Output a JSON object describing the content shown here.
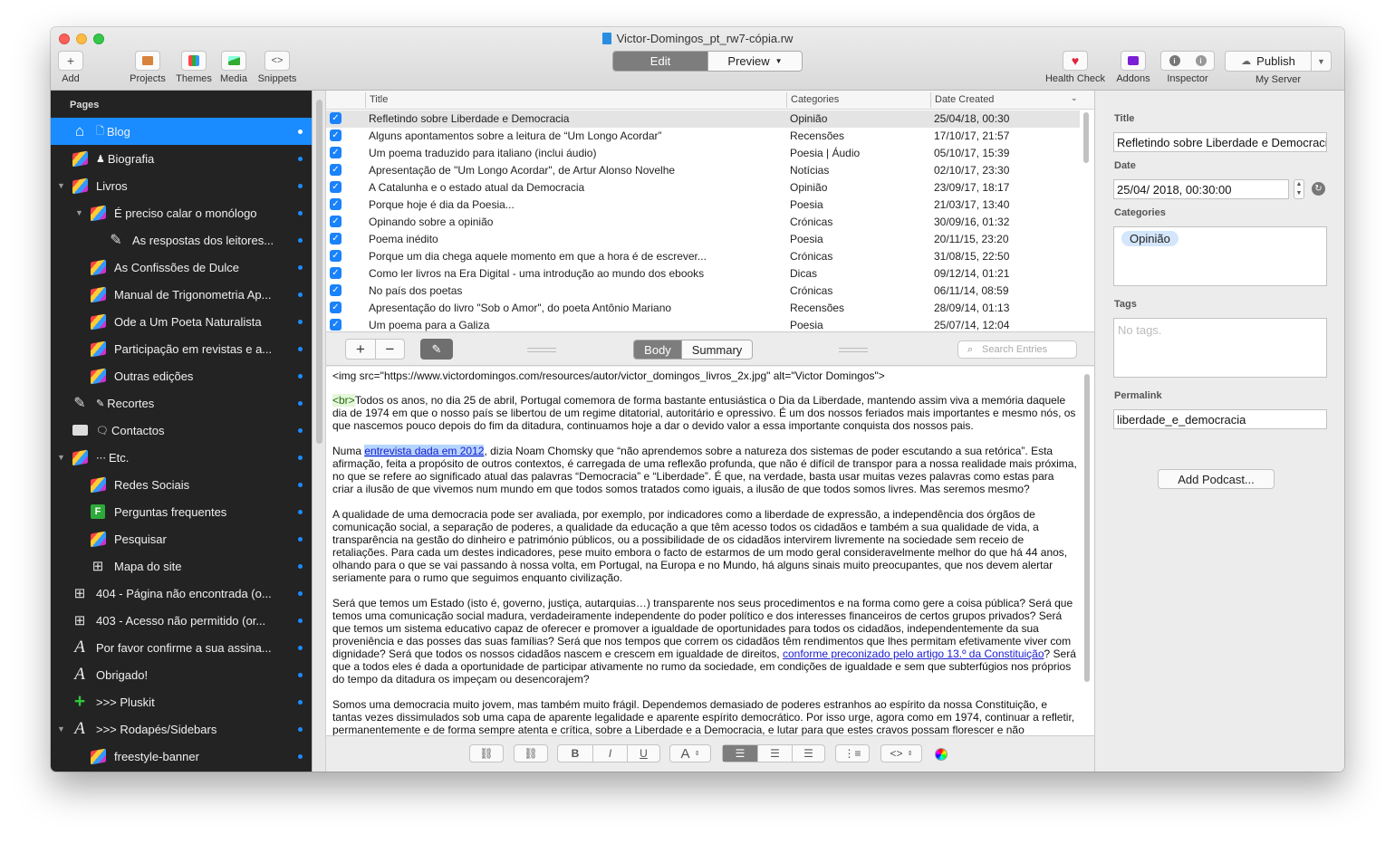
{
  "window": {
    "title": "Victor-Domingos_pt_rw7-cópia.rw"
  },
  "toolbar": {
    "add": "Add",
    "projects": "Projects",
    "themes": "Themes",
    "media": "Media",
    "snippets": "Snippets",
    "edit": "Edit",
    "preview": "Preview",
    "health_check": "Health Check",
    "addons": "Addons",
    "inspector": "Inspector",
    "publish": "Publish",
    "server": "My Server"
  },
  "sidebar": {
    "header": "Pages",
    "items": [
      {
        "label": "Blog",
        "icon": "home-icon"
      },
      {
        "label": "Biografia",
        "icon": "cube-icon"
      },
      {
        "label": "Livros",
        "icon": "cube-icon"
      },
      {
        "label": "É preciso calar o monólogo",
        "icon": "cube-icon"
      },
      {
        "label": "As respostas dos leitores...",
        "icon": "pencil-icon"
      },
      {
        "label": "As Confissões de Dulce",
        "icon": "cube-icon"
      },
      {
        "label": "Manual de Trigonometria Ap...",
        "icon": "cube-icon"
      },
      {
        "label": "Ode a Um Poeta Naturalista",
        "icon": "cube-icon"
      },
      {
        "label": "Participação em revistas e a...",
        "icon": "cube-icon"
      },
      {
        "label": "Outras edições",
        "icon": "cube-icon"
      },
      {
        "label": "Recortes",
        "icon": "pencil-icon"
      },
      {
        "label": "Contactos",
        "icon": "form-icon"
      },
      {
        "label": "Etc.",
        "icon": "cube-icon"
      },
      {
        "label": "Redes Sociais",
        "icon": "cube-icon"
      },
      {
        "label": "Perguntas frequentes",
        "icon": "f-icon"
      },
      {
        "label": "Pesquisar",
        "icon": "cube-icon"
      },
      {
        "label": "Mapa do site",
        "icon": "sitemap-icon"
      },
      {
        "label": "404 - Página não encontrada (o...",
        "icon": "sitemap-icon"
      },
      {
        "label": "403 - Acesso não permitido (or...",
        "icon": "sitemap-icon"
      },
      {
        "label": "Por favor confirme a sua assina...",
        "icon": "font-a-icon"
      },
      {
        "label": "Obrigado!",
        "icon": "font-a-icon"
      },
      {
        "label": ">>> Pluskit",
        "icon": "plus-icon"
      },
      {
        "label": ">>> Rodapés/Sidebars",
        "icon": "font-a-icon"
      },
      {
        "label": "freestyle-banner",
        "icon": "cube-icon"
      }
    ]
  },
  "entries": {
    "columns": [
      "Title",
      "Categories",
      "Date Created"
    ],
    "rows": [
      {
        "title": "Refletindo sobre Liberdade e Democracia",
        "category": "Opinião",
        "date": "25/04/18, 00:30"
      },
      {
        "title": "Alguns apontamentos sobre a leitura de “Um Longo Acordar”",
        "category": "Recensões",
        "date": "17/10/17, 21:57"
      },
      {
        "title": "Um poema traduzido para italiano (inclui áudio)",
        "category": "Poesia | Áudio",
        "date": "05/10/17, 15:39"
      },
      {
        "title": "Apresentação de \"Um Longo Acordar\", de Artur Alonso Novelhe",
        "category": "Notícias",
        "date": "02/10/17, 23:30"
      },
      {
        "title": "A Catalunha e o estado atual da Democracia",
        "category": "Opinião",
        "date": "23/09/17, 18:17"
      },
      {
        "title": "Porque hoje é dia da Poesia...",
        "category": "Poesia",
        "date": "21/03/17, 13:40"
      },
      {
        "title": "Opinando sobre a opinião",
        "category": "Crónicas",
        "date": "30/09/16, 01:32"
      },
      {
        "title": "Poema inédito",
        "category": "Poesia",
        "date": "20/11/15, 23:20"
      },
      {
        "title": "Porque um dia chega aquele momento em que a hora é de escrever...",
        "category": "Crónicas",
        "date": "31/08/15, 22:50"
      },
      {
        "title": "Como ler livros na Era Digital - uma introdução ao mundo dos ebooks",
        "category": "Dicas",
        "date": "09/12/14, 01:21"
      },
      {
        "title": "No país dos poetas",
        "category": "Crónicas",
        "date": "06/11/14, 08:59"
      },
      {
        "title": "Apresentação do livro \"Sob o Amor\", do poeta Antônio Mariano",
        "category": "Recensões",
        "date": "28/09/14, 01:13"
      },
      {
        "title": "Um poema para a Galiza",
        "category": "Poesia",
        "date": "25/07/14, 12:04"
      }
    ]
  },
  "entry_toolbar": {
    "body": "Body",
    "summary": "Summary",
    "search_placeholder": "Search Entries"
  },
  "editor": {
    "p1": "<img src=\"https://www.victordomingos.com/resources/autor/victor_domingos_livros_2x.jpg\" alt=\"Victor Domingos\">",
    "br_tag": "<br>",
    "p2": "Todos os anos, no dia 25 de abril, Portugal comemora de forma bastante entusiástica o Dia da Liberdade, mantendo assim viva a memória daquele dia de 1974 em que o nosso país se libertou de um regime ditatorial, autoritário e opressivo. É um dos nossos feriados mais importantes e mesmo nós, os que nascemos pouco depois do fim da ditadura, continuamos hoje a dar o devido valor a essa importante conquista dos nossos pais.",
    "p3_pre": "Numa ",
    "p3_link": "entrevista dada em 2012",
    "p3_post": ", dizia Noam Chomsky que “não aprendemos sobre a natureza dos sistemas de poder escutando a sua retórica”. Esta afirmação, feita a propósito de outros contextos, é carregada de uma reflexão profunda, que não é difícil de transpor para a nossa realidade mais próxima, no que se refere ao significado atual das palavras “Democracia” e “Liberdade”. É que, na verdade, basta usar muitas vezes palavras como estas para criar a ilusão de que vivemos num mundo em que todos somos tratados como iguais, a ilusão de que todos somos livres. Mas seremos mesmo?",
    "p4": "A qualidade de uma democracia pode ser avaliada, por exemplo, por indicadores como a liberdade de expressão, a independência dos órgãos de comunicação social, a separação de poderes, a qualidade da educação a que têm acesso todos os cidadãos e também a sua qualidade de vida, a transparência na gestão do dinheiro e património públicos, ou a possibilidade de os cidadãos intervirem livremente na sociedade sem receio de retaliações. Para cada um destes indicadores, pese muito embora o facto de estarmos de um modo geral consideravelmente melhor do que há 44 anos, olhando para o que se vai passando à nossa volta, em Portugal, na Europa e no Mundo, há alguns sinais muito preocupantes, que nos devem alertar seriamente para o rumo que seguimos enquanto civilização.",
    "p5_pre": "Será que temos um Estado (isto é, governo, justiça, autarquias…) transparente nos seus procedimentos e na forma como gere a coisa pública? Será que temos uma comunicação social madura, verdadeiramente independente do poder político e dos interesses financeiros de certos grupos privados? Será que temos um sistema educativo capaz de oferecer e promover a igualdade de oportunidades para todos os cidadãos, independentemente da sua proveniência e das posses das suas famílias? Será que nos tempos que correm os cidadãos têm rendimentos que lhes permitam efetivamente viver com dignidade? Será que todos os nossos cidadãos nascem e crescem em igualdade de direitos, ",
    "p5_link": "conforme preconizado pelo artigo 13.º da Constituição",
    "p5_post": "? Será que a todos eles é dada a oportunidade de participar ativamente no rumo da sociedade, em condições de igualdade e sem que subterfúgios nos próprios do tempo da ditadura os impeçam ou desencorajem?",
    "p6": "Somos uma democracia muito jovem, mas também muito frágil. Dependemos demasiado de poderes estranhos ao espírito da nossa Constituição, e tantas vezes dissimulados sob uma capa de aparente legalidade e aparente espírito democrático. Por isso urge, agora como em 1974, continuar a refletir, permanentemente e de forma sempre atenta e crítica, sobre a Liberdade e a Democracia, e lutar para que estes cravos possam florescer e não"
  },
  "format_toolbar": {
    "bold": "B",
    "italic": "I",
    "underline": "U",
    "font": "A",
    "code": "<>"
  },
  "inspector": {
    "title_label": "Title",
    "title_value": "Refletindo sobre Liberdade e Democracia",
    "date_label": "Date",
    "date_value": "25/04/ 2018, 00:30:00",
    "categories_label": "Categories",
    "category_chip": "Opinião",
    "tags_label": "Tags",
    "tags_placeholder": "No tags.",
    "permalink_label": "Permalink",
    "permalink_value": "liberdade_e_democracia",
    "add_podcast": "Add Podcast..."
  },
  "colors": {
    "accent": "#1a8cff",
    "sidebar_bg": "#232323",
    "selection": "#e4e4e4"
  }
}
